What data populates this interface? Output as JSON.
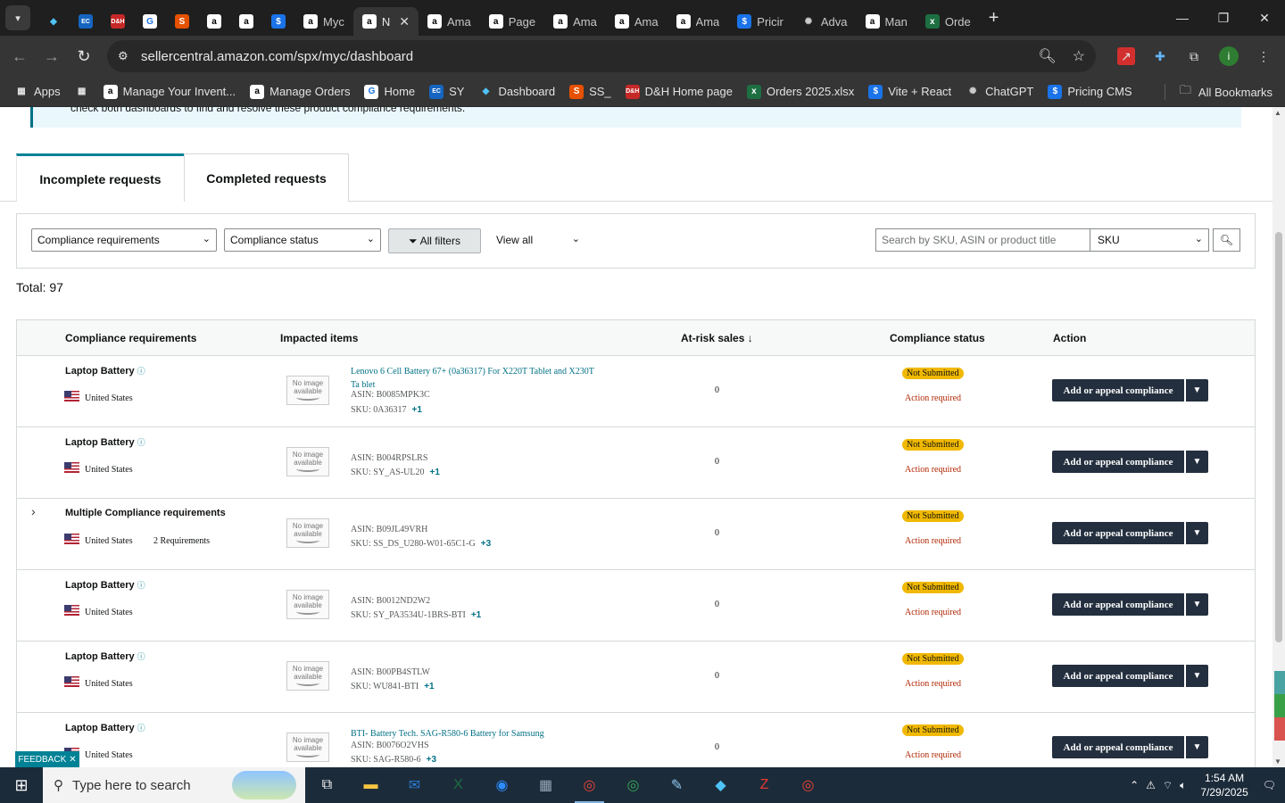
{
  "browser": {
    "tabs": [
      {
        "label": "",
        "icon": "blue-diamond-icon",
        "color": "#1a73e8"
      },
      {
        "label": "",
        "icon": "ec-icon",
        "color": "#1565c0"
      },
      {
        "label": "",
        "icon": "dh-icon",
        "color": "#c62828"
      },
      {
        "label": "",
        "icon": "g-icon",
        "color": "#1a73e8"
      },
      {
        "label": "",
        "icon": "ss-icon",
        "color": "#e65100"
      },
      {
        "label": "",
        "icon": "amazon-icon",
        "color": "#ffffff"
      },
      {
        "label": "",
        "icon": "amazon-icon",
        "color": "#ffffff"
      },
      {
        "label": "",
        "icon": "dollar-icon",
        "color": "#1a73e8"
      },
      {
        "label": "Myc",
        "icon": "amazon-icon",
        "color": "#ffffff"
      },
      {
        "label": "N",
        "icon": "amazon-icon",
        "color": "#ffffff",
        "active": true
      },
      {
        "label": "Ama",
        "icon": "amazon-icon",
        "color": "#ffffff"
      },
      {
        "label": "Page",
        "icon": "amazon-icon",
        "color": "#ffffff"
      },
      {
        "label": "Ama",
        "icon": "amazon-icon",
        "color": "#ffffff"
      },
      {
        "label": "Ama",
        "icon": "amazon-icon",
        "color": "#ffffff"
      },
      {
        "label": "Ama",
        "icon": "amazon-icon",
        "color": "#ffffff"
      },
      {
        "label": "Pricir",
        "icon": "dollar-icon",
        "color": "#1a73e8"
      },
      {
        "label": "Adva",
        "icon": "openai-icon",
        "color": "#cccccc"
      },
      {
        "label": "Man",
        "icon": "amazon-icon",
        "color": "#ffffff"
      },
      {
        "label": "Orde",
        "icon": "excel-icon",
        "color": "#1d6f42"
      }
    ],
    "url": "sellercentral.amazon.com/spx/myc/dashboard",
    "bookmarks": [
      {
        "label": "Apps",
        "icon": "apps-grid-icon"
      },
      {
        "label": "",
        "icon": "grid-icon"
      },
      {
        "label": "Manage Your Invent...",
        "icon": "amazon-icon"
      },
      {
        "label": "Manage Orders",
        "icon": "amazon-icon"
      },
      {
        "label": "Home",
        "icon": "g-icon"
      },
      {
        "label": "SY",
        "icon": "ec-icon"
      },
      {
        "label": "Dashboard",
        "icon": "blue-diamond-icon"
      },
      {
        "label": "SS_",
        "icon": "ss-icon"
      },
      {
        "label": "D&H Home page",
        "icon": "dh-icon"
      },
      {
        "label": "Orders 2025.xlsx",
        "icon": "excel-icon"
      },
      {
        "label": "Vite + React",
        "icon": "dollar-icon"
      },
      {
        "label": "ChatGPT",
        "icon": "openai-icon"
      },
      {
        "label": "Pricing CMS",
        "icon": "dollar-icon"
      }
    ],
    "all_bookmarks": "All Bookmarks"
  },
  "banner": {
    "text": "check both dashboards to find and resolve these product compliance requirements."
  },
  "page_tabs": {
    "incomplete": "Incomplete requests",
    "completed": "Completed requests"
  },
  "filters": {
    "compliance_requirements": "Compliance requirements",
    "compliance_status": "Compliance status",
    "all_filters": "All filters",
    "view_all": "View all",
    "search_placeholder": "Search by SKU, ASIN or product title",
    "search_type": "SKU"
  },
  "total": "Total: 97",
  "table": {
    "headers": {
      "requirements": "Compliance requirements",
      "impacted": "Impacted items",
      "atrisk": "At-risk sales",
      "status": "Compliance status",
      "action": "Action"
    },
    "rows": [
      {
        "req": "Laptop Battery",
        "country": "United States",
        "title": "Lenovo 6 Cell Battery 67+ (0a36317) For X220T Tablet and X230T Ta blet",
        "asin": "ASIN: B0085MPK3C",
        "sku": "SKU: 0A36317",
        "plus": "+1",
        "atrisk": "0",
        "status": "Not Submitted",
        "action_note": "Action required",
        "action": "Add or appeal compliance"
      },
      {
        "req": "Laptop Battery",
        "country": "United States",
        "title": "",
        "asin": "ASIN: B004RPSLRS",
        "sku": "SKU: SY_AS-UL20",
        "plus": "+1",
        "atrisk": "0",
        "status": "Not Submitted",
        "action_note": "Action required",
        "action": "Add or appeal compliance"
      },
      {
        "req": "Multiple Compliance requirements",
        "country": "United States",
        "req_count": "2 Requirements",
        "title": "",
        "asin": "ASIN: B09JL49VRH",
        "sku": "SKU: SS_DS_U280-W01-65C1-G",
        "plus": "+3",
        "atrisk": "0",
        "status": "Not Submitted",
        "action_note": "Action required",
        "action": "Add or appeal compliance"
      },
      {
        "req": "Laptop Battery",
        "country": "United States",
        "title": "",
        "asin": "ASIN: B0012ND2W2",
        "sku": "SKU: SY_PA3534U-1BRS-BTI",
        "plus": "+1",
        "atrisk": "0",
        "status": "Not Submitted",
        "action_note": "Action required",
        "action": "Add or appeal compliance"
      },
      {
        "req": "Laptop Battery",
        "country": "United States",
        "title": "",
        "asin": "ASIN: B00PB4STLW",
        "sku": "SKU: WU841-BTI",
        "plus": "+1",
        "atrisk": "0",
        "status": "Not Submitted",
        "action_note": "Action required",
        "action": "Add or appeal compliance"
      },
      {
        "req": "Laptop Battery",
        "country": "United States",
        "title": "BTI- Battery Tech. SAG-R580-6 Battery for Samsung",
        "asin": "ASIN: B0076O2VHS",
        "sku": "SKU: SAG-R580-6",
        "plus": "+3",
        "atrisk": "0",
        "status": "Not Submitted",
        "action_note": "Action required",
        "action": "Add or appeal compliance"
      }
    ],
    "no_image": "No image available"
  },
  "feedback": "FEEDBACK",
  "taskbar": {
    "search_placeholder": "Type here to search",
    "time": "1:54 AM",
    "date": "7/29/2025"
  }
}
